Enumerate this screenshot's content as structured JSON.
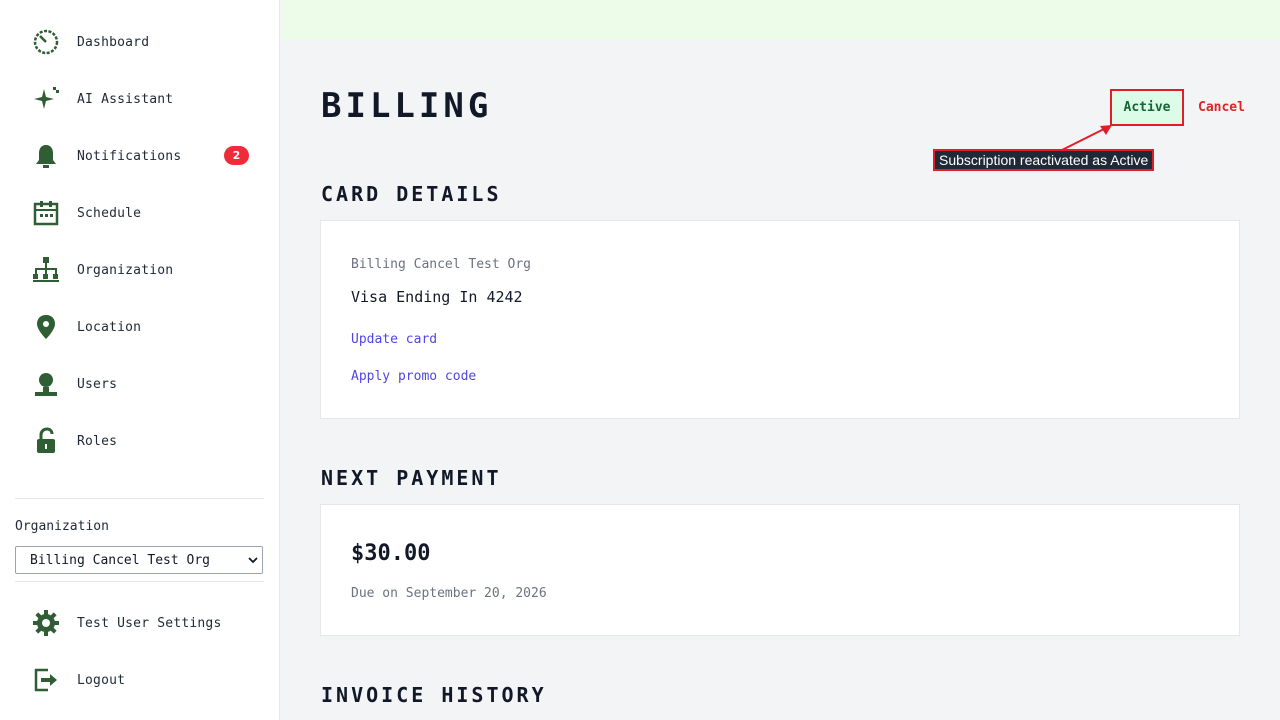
{
  "sidebar": {
    "items": [
      {
        "label": "Dashboard",
        "icon": "dashboard-icon"
      },
      {
        "label": "AI Assistant",
        "icon": "sparkle-icon"
      },
      {
        "label": "Notifications",
        "icon": "bell-icon",
        "badge": "2"
      },
      {
        "label": "Schedule",
        "icon": "calendar-icon"
      },
      {
        "label": "Organization",
        "icon": "org-chart-icon"
      },
      {
        "label": "Location",
        "icon": "location-pin-icon"
      },
      {
        "label": "Users",
        "icon": "user-icon"
      },
      {
        "label": "Roles",
        "icon": "lock-icon"
      }
    ],
    "organization_label": "Organization",
    "organization_selected": "Billing Cancel Test Org",
    "settings_label": "Test User Settings",
    "logout_label": "Logout"
  },
  "page": {
    "title": "BILLING",
    "status": "Active",
    "cancel_label": "Cancel",
    "annotation": "Subscription reactivated as Active"
  },
  "card_details": {
    "heading": "CARD DETAILS",
    "org_name": "Billing Cancel Test Org",
    "card": "Visa Ending In 4242",
    "update_link": "Update card",
    "promo_link": "Apply promo code"
  },
  "next_payment": {
    "heading": "NEXT PAYMENT",
    "amount": "$30.00",
    "due": "Due on September 20, 2026"
  },
  "invoice_history": {
    "heading": "INVOICE HISTORY"
  },
  "colors": {
    "icon_green": "#2f5d34",
    "badge_red": "#ef2b3a",
    "link_indigo": "#4f46e5",
    "cancel_red": "#dc2626",
    "active_bg": "#dcfce7",
    "topbar_bg": "#edfce8"
  }
}
